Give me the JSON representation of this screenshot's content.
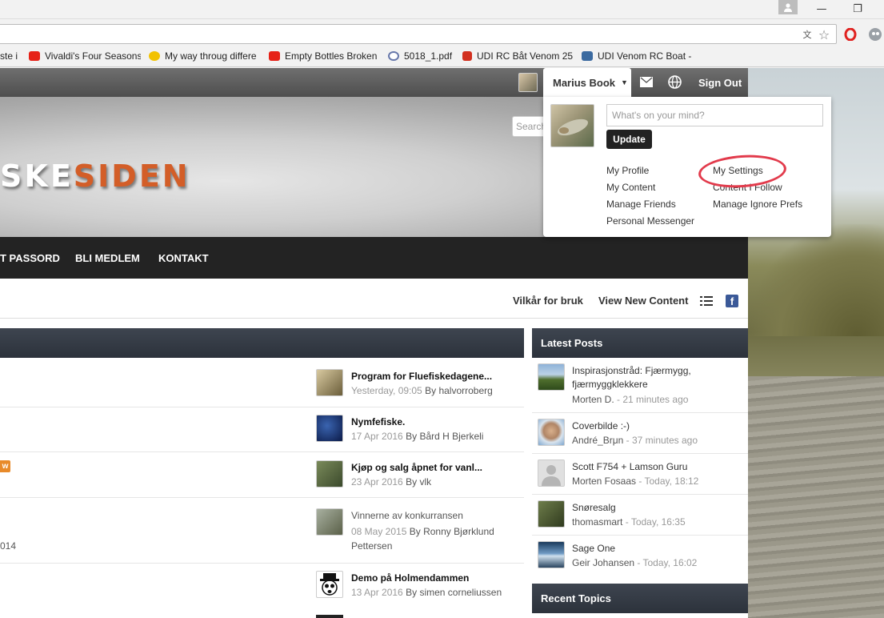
{
  "browser": {
    "bookmarks": [
      {
        "label": "ste i",
        "color": "#dddddd"
      },
      {
        "label": "Vivaldi's Four Seasons",
        "color": "#e62117"
      },
      {
        "label": "My way throug differe",
        "color": "#f2c200"
      },
      {
        "label": "Empty Bottles Broken",
        "color": "#e62117"
      },
      {
        "label": "5018_1.pdf",
        "color": "#6677aa"
      },
      {
        "label": "UDI RC Båt Venom 25",
        "color": "#d22f1e"
      },
      {
        "label": "UDI Venom RC Boat -",
        "color": "#3b6aa0"
      }
    ],
    "minimize_label": "—",
    "restore_label": "❐"
  },
  "userbar": {
    "user_name": "Marius Book",
    "sign_out": "Sign Out"
  },
  "header": {
    "logo_part1": "SKE",
    "logo_part2": "SIDEN",
    "search_placeholder": "Search"
  },
  "nav": {
    "items": [
      "T PASSORD",
      "BLI MEDLEM",
      "KONTAKT"
    ]
  },
  "secondary_nav": {
    "terms": "Vilkår for bruk",
    "new_content": "View New Content"
  },
  "dropdown": {
    "status_placeholder": "What's on your mind?",
    "update_label": "Update",
    "links_col1": [
      "My Profile",
      "My Content",
      "Manage Friends",
      "Personal Messenger"
    ],
    "links_col2": [
      "My Settings",
      "Content I Follow",
      "Manage Ignore Prefs"
    ]
  },
  "topics": [
    {
      "title": "Program for Fluefiskedagene...",
      "date": "Yesterday, 09:05",
      "by": "By",
      "author": "halvorroberg",
      "bold": true
    },
    {
      "title": "Nymfefiske.",
      "date": "17 Apr 2016",
      "by": "By",
      "author": "Bård H Bjerkeli",
      "bold": true
    },
    {
      "title": "Kjøp og salg åpnet for vanl...",
      "date": "23 Apr 2016",
      "by": "By",
      "author": "vlk",
      "bold": true
    },
    {
      "title": "Vinnerne av konkurransen",
      "date": "08 May 2015",
      "by": "By",
      "author": "Ronny Bjørklund Pettersen",
      "bold": false
    },
    {
      "title": "Demo på Holmendammen",
      "date": "13 Apr 2016",
      "by": "By",
      "author": "simen corneliussen",
      "bold": true
    }
  ],
  "left_fragments": {
    "badge": "w",
    "year": "014"
  },
  "latest_posts": {
    "title": "Latest Posts",
    "items": [
      {
        "title": "Inspirasjonstråd: Fjærmygg, fjærmyggklekkere",
        "author": "Morten D.",
        "time": "- 21 minutes ago"
      },
      {
        "title": "Coverbilde :-)",
        "author": "André_Brμn",
        "time": "- 37 minutes ago"
      },
      {
        "title": "Scott F754 + Lamson Guru",
        "author": "Morten Fosaas",
        "time": "- Today, 18:12"
      },
      {
        "title": "Snøresalg",
        "author": "thomasmart",
        "time": "- Today, 16:35"
      },
      {
        "title": "Sage One",
        "author": "Geir Johansen",
        "time": "- Today, 16:02"
      }
    ]
  },
  "recent_topics": {
    "title": "Recent Topics"
  },
  "colors": {
    "accent": "#d35e28",
    "annotation": "#e23b4c"
  }
}
